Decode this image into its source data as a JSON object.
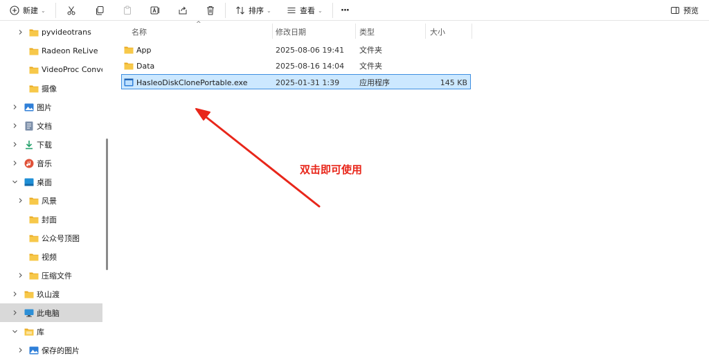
{
  "toolbar": {
    "new_label": "新建",
    "sort_label": "排序",
    "view_label": "查看",
    "more_label": "···",
    "preview_label": "预览"
  },
  "sidebar": {
    "items": [
      {
        "label": "pyvideotrans",
        "icon": "folder-icon",
        "expandable": true
      },
      {
        "label": "Radeon ReLive",
        "icon": "folder-icon",
        "expandable": false
      },
      {
        "label": "VideoProc Conver",
        "icon": "folder-icon",
        "expandable": false
      },
      {
        "label": "摄像",
        "icon": "folder-icon",
        "expandable": false
      },
      {
        "label": "图片",
        "icon": "pictures-icon",
        "expandable": true
      },
      {
        "label": "文档",
        "icon": "documents-icon",
        "expandable": true
      },
      {
        "label": "下载",
        "icon": "downloads-icon",
        "expandable": true
      },
      {
        "label": "音乐",
        "icon": "music-icon",
        "expandable": true
      },
      {
        "label": "桌面",
        "icon": "desktop-icon",
        "expandable": true,
        "expanded": true
      },
      {
        "label": "风景",
        "icon": "folder-icon",
        "expandable": true
      },
      {
        "label": "封面",
        "icon": "folder-icon",
        "expandable": false
      },
      {
        "label": "公众号顶图",
        "icon": "folder-icon",
        "expandable": false
      },
      {
        "label": "视频",
        "icon": "folder-icon",
        "expandable": false
      },
      {
        "label": "压缩文件",
        "icon": "folder-icon",
        "expandable": true
      },
      {
        "label": "玖山渡",
        "icon": "folder-icon",
        "expandable": true
      },
      {
        "label": "此电脑",
        "icon": "computer-icon",
        "expandable": true,
        "selected": true
      },
      {
        "label": "库",
        "icon": "library-icon",
        "expandable": true,
        "expanded": true
      },
      {
        "label": "保存的图片",
        "icon": "pictures-icon",
        "expandable": true
      }
    ]
  },
  "columns": {
    "name": "名称",
    "modified": "修改日期",
    "type": "类型",
    "size": "大小"
  },
  "files": [
    {
      "name": "App",
      "modified": "2025-08-06 19:41",
      "type": "文件夹",
      "size": "",
      "icon": "folder-icon"
    },
    {
      "name": "Data",
      "modified": "2025-08-16 14:04",
      "type": "文件夹",
      "size": "",
      "icon": "folder-icon"
    },
    {
      "name": "HasleoDiskClonePortable.exe",
      "modified": "2025-01-31 1:39",
      "type": "应用程序",
      "size": "145 KB",
      "icon": "exe-icon",
      "selected": true
    }
  ],
  "annotation": {
    "text": "双击即可使用",
    "color": "#e8261a"
  },
  "colors": {
    "accent": "#3d8ee0",
    "selection_bg": "#cce8ff",
    "folder": "#f2c04c"
  }
}
